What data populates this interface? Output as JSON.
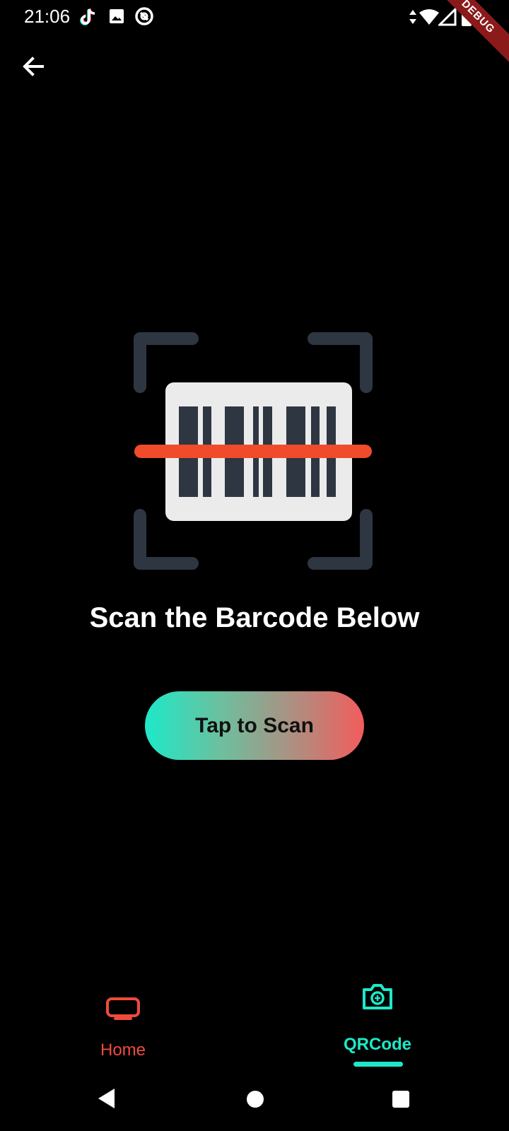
{
  "status_bar": {
    "time": "21:06",
    "icons": [
      "tiktok-icon",
      "image-icon",
      "vpn-icon",
      "data-arrows-icon",
      "wifi-icon",
      "signal-icon",
      "battery-icon"
    ]
  },
  "debug_banner": "DEBUG",
  "header": {
    "back_icon": "arrow-left-icon"
  },
  "illustration": {
    "icon": "barcode-scan-icon"
  },
  "main": {
    "headline": "Scan the Barcode Below",
    "scan_button_label": "Tap to Scan"
  },
  "bottom_nav": {
    "items": [
      {
        "label": "Home",
        "icon": "tv-icon",
        "active": false
      },
      {
        "label": "QRCode",
        "icon": "camera-icon",
        "active": true
      }
    ]
  },
  "system_nav": {
    "icons": [
      "back-triangle-icon",
      "home-circle-icon",
      "recents-square-icon"
    ]
  },
  "colors": {
    "background": "#000000",
    "accent_teal": "#1de9c8",
    "accent_red": "#f04b3a",
    "scan_line": "#f04b2a",
    "frame": "#2e3642",
    "barcode_card": "#ebebeb"
  }
}
